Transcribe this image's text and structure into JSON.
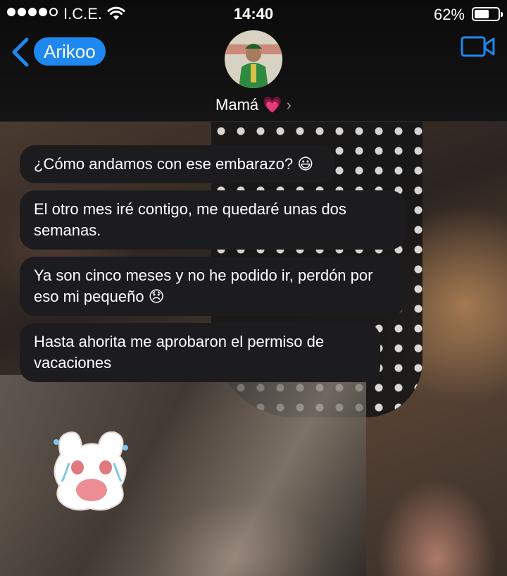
{
  "status_bar": {
    "carrier": "I.C.E.",
    "time": "14:40",
    "battery_percent_label": "62%",
    "battery_level": 0.62,
    "signal_bars_filled": 4,
    "signal_bars_total": 5
  },
  "header": {
    "back_label": "Arikoo",
    "contact_name": "Mamá 💗",
    "chevron": "›",
    "accent_color": "#1e88f0"
  },
  "messages": [
    {
      "text": "¿Cómo andamos con ese embarazo? 😃"
    },
    {
      "text": "El otro mes iré contigo, me quedaré unas dos semanas."
    },
    {
      "text": "Ya son cinco meses y no he podido ir, perdón por eso mi pequeño 😞"
    },
    {
      "text": "Hasta ahorita me aprobaron el permiso de vacaciones"
    }
  ],
  "icons": {
    "back": "chevron-left-icon",
    "video": "video-camera-icon",
    "wifi": "wifi-icon",
    "battery": "battery-icon",
    "sticker": "crying-bunny-sticker"
  }
}
